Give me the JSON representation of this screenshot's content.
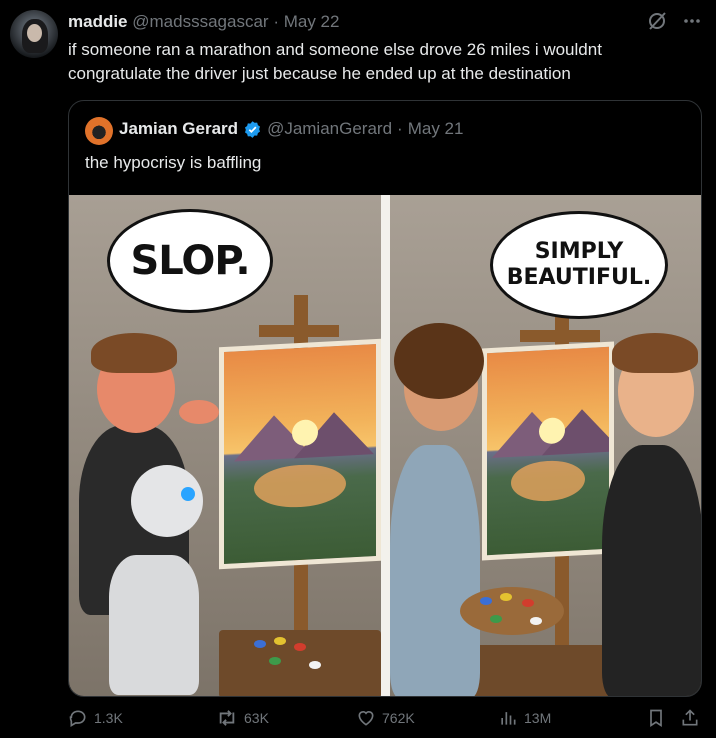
{
  "tweet": {
    "author_name": "maddie",
    "author_handle": "@madsssagascar",
    "separator": "·",
    "date": "May 22",
    "text": "if someone ran a marathon and someone else drove 26 miles i wouldnt congratulate the driver just because he ended up at the destination"
  },
  "quoted": {
    "author_name": "Jamian Gerard",
    "author_handle": "@JamianGerard",
    "separator": "·",
    "date": "May 21",
    "text": "the hypocrisy is baffling",
    "comic": {
      "left_bubble": "SLOP.",
      "right_bubble_line1": "SIMPLY",
      "right_bubble_line2": "BEAUTIFUL."
    }
  },
  "actions": {
    "replies": "1.3K",
    "reposts": "63K",
    "likes": "762K",
    "views": "13M"
  },
  "icons": {
    "reply": "reply-icon",
    "repost": "repost-icon",
    "like": "heart-icon",
    "views": "views-icon",
    "bookmark": "bookmark-icon",
    "share": "share-icon",
    "grok": "grok-icon",
    "more": "more-icon",
    "verified": "verified-badge-icon"
  },
  "colors": {
    "background": "#000000",
    "text": "#e7e9ea",
    "muted": "#71767b",
    "verified": "#1d9bf0"
  }
}
